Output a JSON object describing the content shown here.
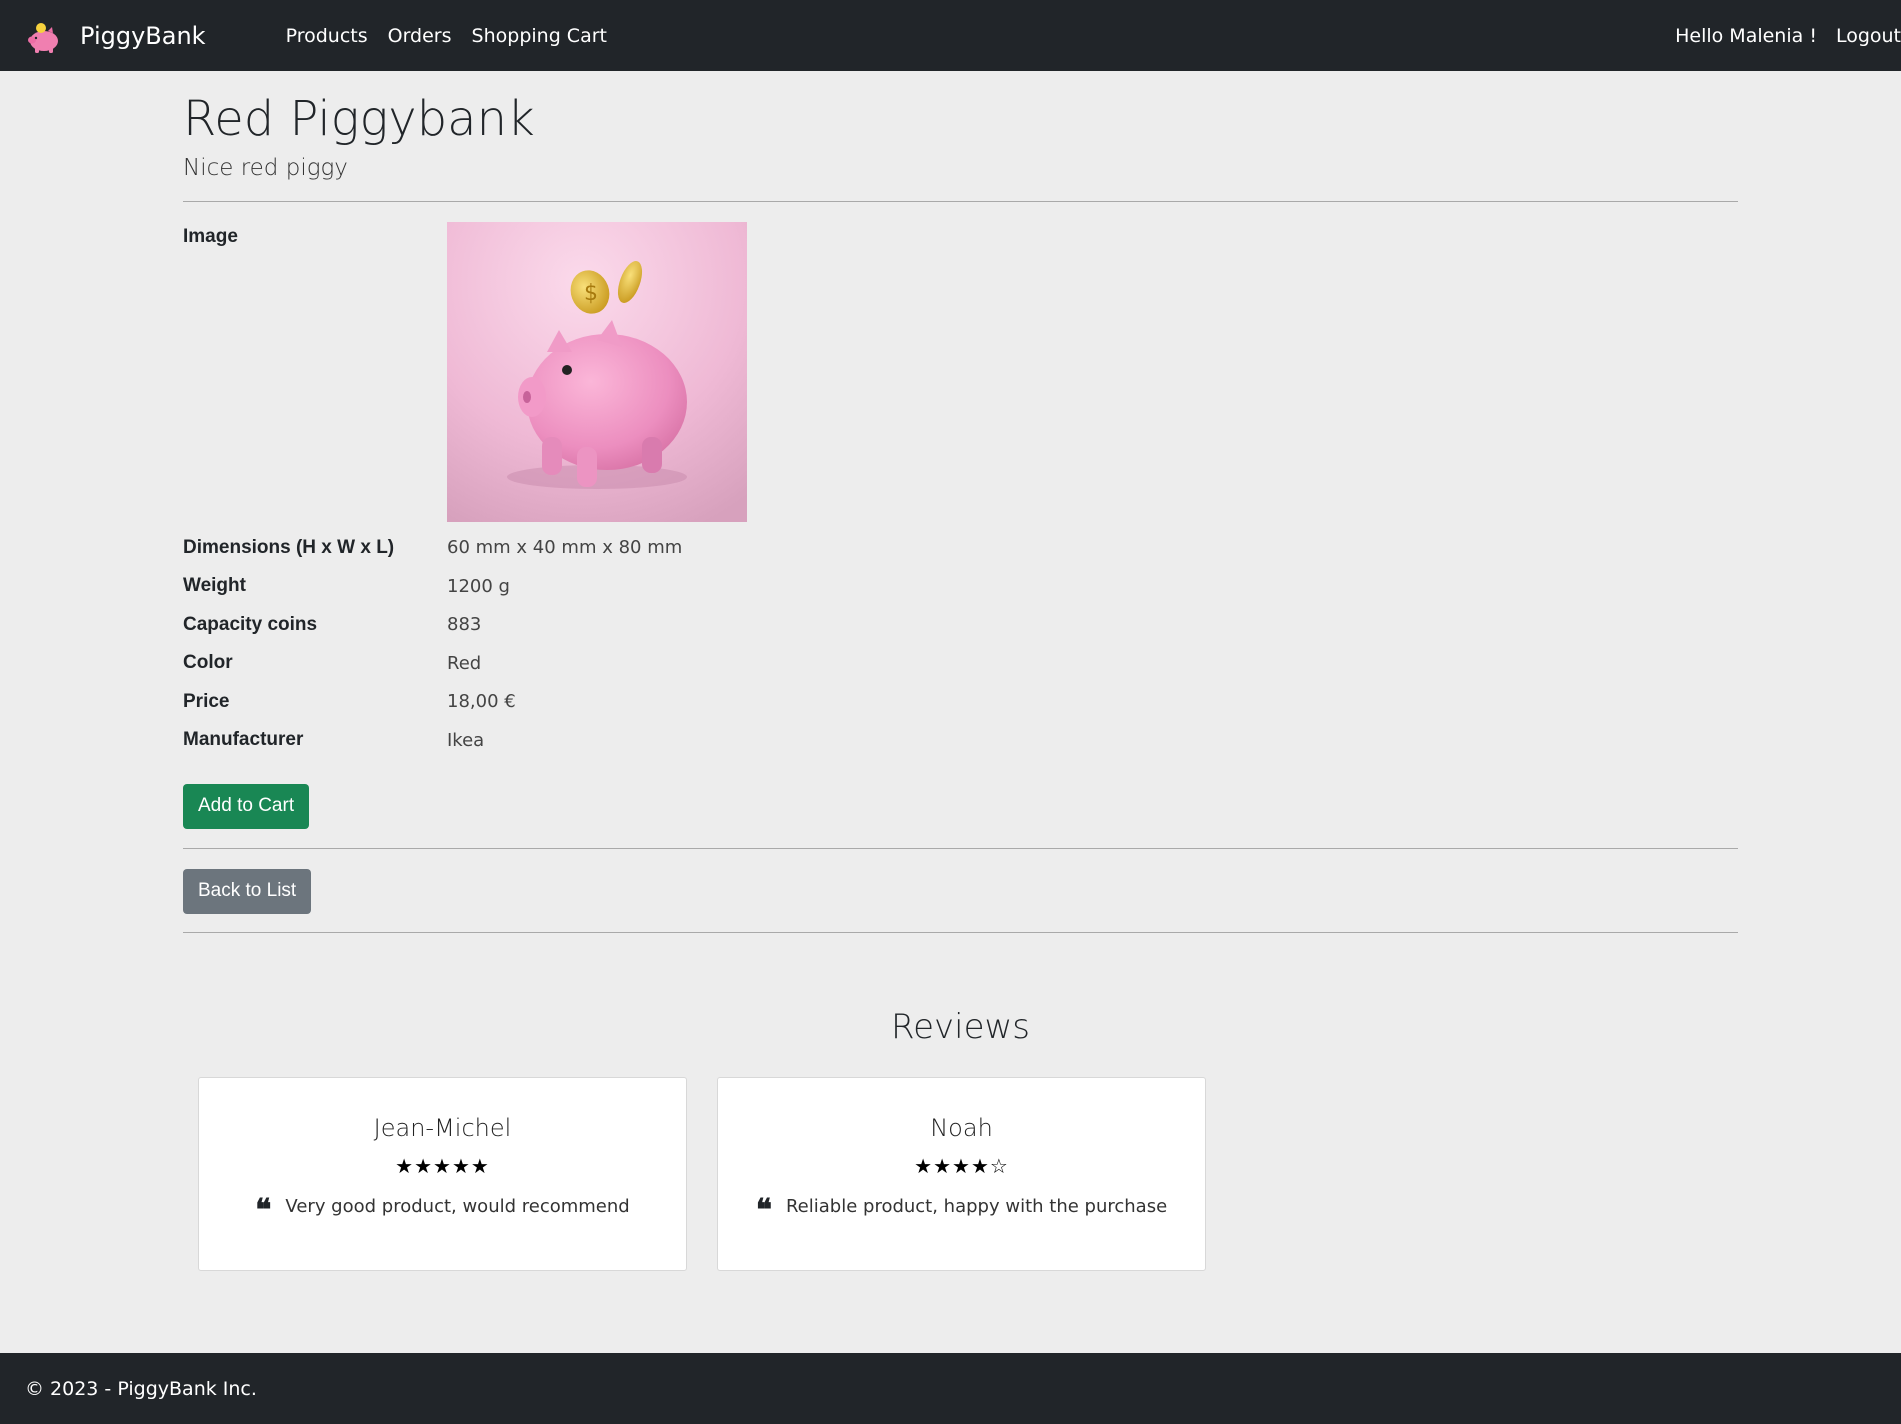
{
  "navbar": {
    "brand": "PiggyBank",
    "links": [
      "Products",
      "Orders",
      "Shopping Cart"
    ],
    "greeting": "Hello Malenia !",
    "logout": "Logout"
  },
  "product": {
    "title": "Red Piggybank",
    "subtitle": "Nice red piggy",
    "image_label": "Image",
    "attributes": [
      {
        "label": "Dimensions (H x W x L)",
        "value": "60 mm x 40 mm x 80 mm"
      },
      {
        "label": "Weight",
        "value": "1200 g"
      },
      {
        "label": "Capacity coins",
        "value": "883"
      },
      {
        "label": "Color",
        "value": "Red"
      },
      {
        "label": "Price",
        "value": "18,00 €"
      },
      {
        "label": "Manufacturer",
        "value": "Ikea"
      }
    ]
  },
  "actions": {
    "add_to_cart": "Add to Cart",
    "back_to_list": "Back to List"
  },
  "reviews": {
    "title": "Reviews",
    "items": [
      {
        "name": "Jean-Michel",
        "stars": "★★★★★",
        "rating": 5,
        "text": "Very good product, would recommend"
      },
      {
        "name": "Noah",
        "stars": "★★★★☆",
        "rating": 4,
        "text": "Reliable product, happy with the purchase"
      }
    ]
  },
  "footer": {
    "text": "© 2023 - PiggyBank Inc."
  },
  "colors": {
    "navbar_bg": "#212529",
    "page_bg": "#ededed",
    "success": "#198754",
    "secondary": "#6c757d",
    "brand_pig": "#f07fb0"
  }
}
